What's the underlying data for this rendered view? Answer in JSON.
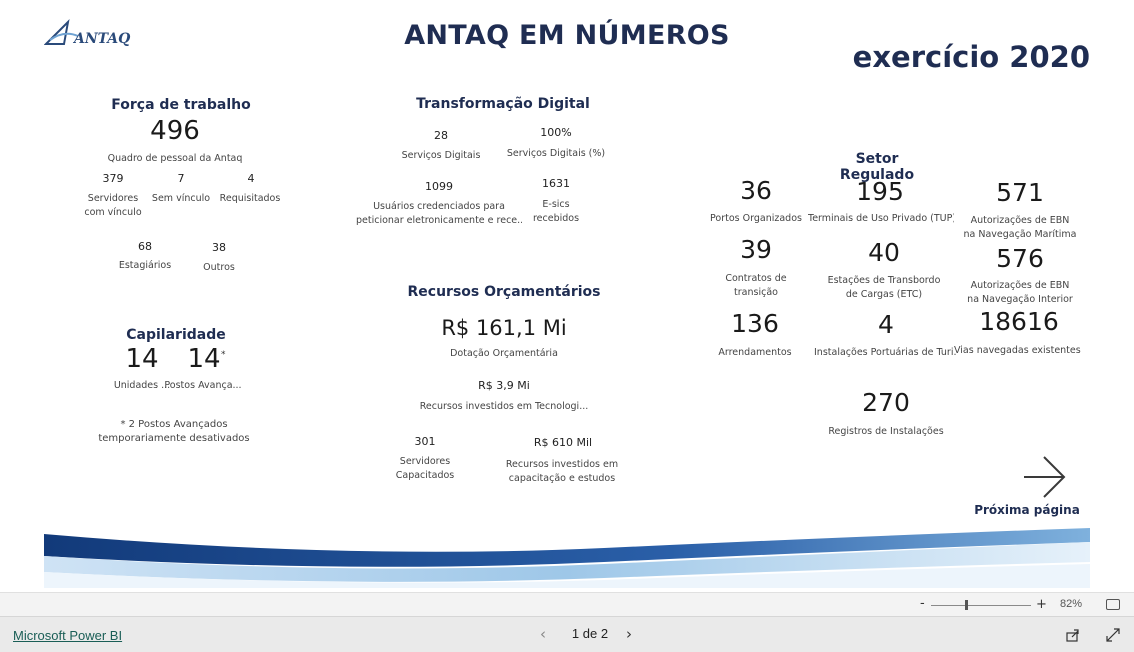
{
  "report": {
    "title": "ANTAQ EM NÚMEROS",
    "year": "exercício 2020",
    "logo_text": "ANTAQ"
  },
  "forca": {
    "title": "Força de trabalho",
    "total": "496",
    "total_label": "Quadro de pessoal da Antaq",
    "servidores": "379",
    "servidores_label_1": "Servidores",
    "servidores_label_2": "com vínculo",
    "sem_vinculo": "7",
    "sem_vinculo_label": "Sem vínculo",
    "requisitados": "4",
    "requisitados_label": "Requisitados",
    "estagiarios": "68",
    "estagiarios_label": "Estagiários",
    "outros": "38",
    "outros_label": "Outros"
  },
  "capilaridade": {
    "title": "Capilaridade",
    "unidades": "14",
    "unidades_label": "Unidades ...",
    "postos": "14",
    "postos_star": "*",
    "postos_label": "Postos Avança...",
    "note_1": "* 2 Postos Avançados",
    "note_2": "temporariamente desativados"
  },
  "digital": {
    "title": "Transformação Digital",
    "servicos": "28",
    "servicos_label": "Serviços Digitais",
    "servicos_pct": "100%",
    "servicos_pct_label": "Serviços Digitais (%)",
    "usuarios": "1099",
    "usuarios_label_1": "Usuários credenciados para",
    "usuarios_label_2": "peticionar eletronicamente e rece...",
    "esics": "1631",
    "esics_label_1": "E-sics",
    "esics_label_2": "recebidos"
  },
  "recursos": {
    "title": "Recursos Orçamentários",
    "dotacao": "R$ 161,1 Mi",
    "dotacao_label": "Dotação Orçamentária",
    "tecnologia": "R$ 3,9 Mi",
    "tecnologia_label": "Recursos investidos em Tecnologi...",
    "capacitados": "301",
    "capacitados_label_1": "Servidores",
    "capacitados_label_2": "Capacitados",
    "capacitacao": "R$ 610 Mil",
    "capacitacao_label_1": "Recursos investidos em",
    "capacitacao_label_2": "capacitação e estudos"
  },
  "setor": {
    "title": "Setor Regulado",
    "portos": "36",
    "portos_label": "Portos Organizados",
    "tup": "195",
    "tup_label": "Terminais de Uso Privado (TUP)",
    "ebn_mar": "571",
    "ebn_mar_label_1": "Autorizações de EBN",
    "ebn_mar_label_2": "na Navegação Marítima",
    "contratos": "39",
    "contratos_label_1": "Contratos de",
    "contratos_label_2": "transição",
    "etc": "40",
    "etc_label_1": "Estações de Transbordo",
    "etc_label_2": "de Cargas (ETC)",
    "ebn_int": "576",
    "ebn_int_label_1": "Autorizações de EBN",
    "ebn_int_label_2": "na Navegação Interior",
    "arrend": "136",
    "arrend_label": "Arrendamentos",
    "turismo": "4",
    "turismo_label": "Instalações Portuárias de Turi...",
    "vias": "18616",
    "vias_label": "Vias navegadas existentes ...",
    "registros": "270",
    "registros_label": "Registros de Instalações"
  },
  "nav": {
    "next_label": "Próxima página"
  },
  "viewer": {
    "zoom_pct": "82%",
    "zoom_level": 0.35,
    "page_indicator": "1 de 2",
    "brand_link": "Microsoft Power BI"
  },
  "colors": {
    "navy": "#1f2d52",
    "wave_dark": "#1c4a8c",
    "wave_light": "#9ec7e8",
    "link": "#1a5e56"
  },
  "icons": [
    "antaq-logo",
    "next-arrow-icon",
    "minus-icon",
    "plus-icon",
    "fit-page-icon",
    "prev-page-icon",
    "next-page-icon",
    "share-icon",
    "fullscreen-icon"
  ]
}
